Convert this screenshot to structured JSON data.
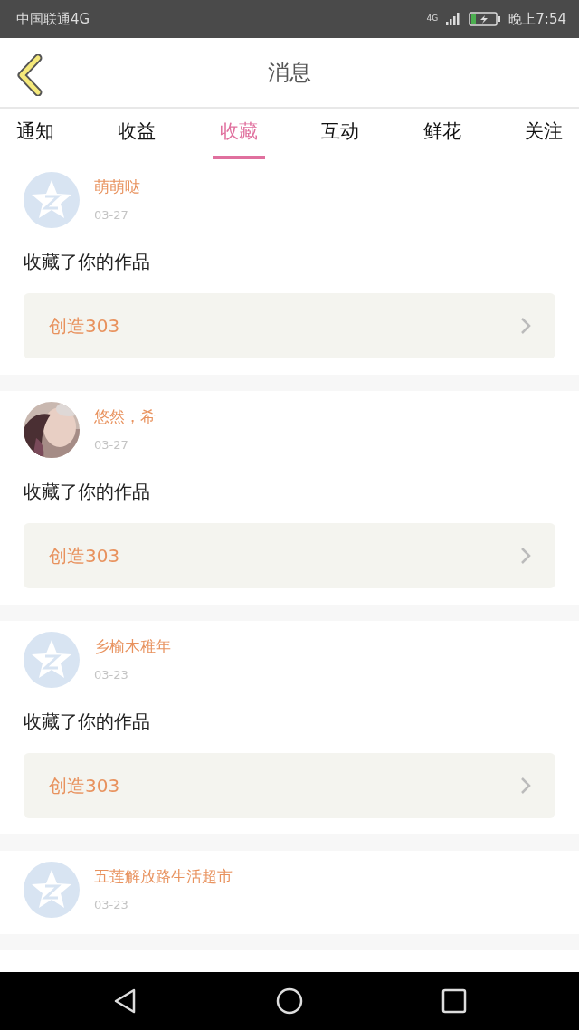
{
  "status_bar": {
    "carrier": "中国联通4G",
    "network": "4G",
    "time": "晚上7:54",
    "battery_charging": true
  },
  "header": {
    "title": "消息"
  },
  "tabs": [
    {
      "label": "通知",
      "selected": false
    },
    {
      "label": "收益",
      "selected": false
    },
    {
      "label": "收藏",
      "selected": true
    },
    {
      "label": "互动",
      "selected": false
    },
    {
      "label": "鲜花",
      "selected": false
    },
    {
      "label": "关注",
      "selected": false
    }
  ],
  "messages": [
    {
      "avatar": {
        "kind": "default"
      },
      "name": "萌萌哒",
      "date": "03-27",
      "text": "收藏了你的作品",
      "work": "创造303"
    },
    {
      "name": "悠然，希",
      "date": "03-27",
      "text": "收藏了你的作品",
      "work": "创造303"
    },
    {
      "avatar": {
        "kind": "default"
      },
      "name": "乡榆木稚年",
      "date": "03-23",
      "text": "收藏了你的作品",
      "work": "创造303"
    },
    {
      "avatar": {
        "kind": "default"
      },
      "name": "五莲解放路生活超市",
      "date": "03-23"
    }
  ]
}
